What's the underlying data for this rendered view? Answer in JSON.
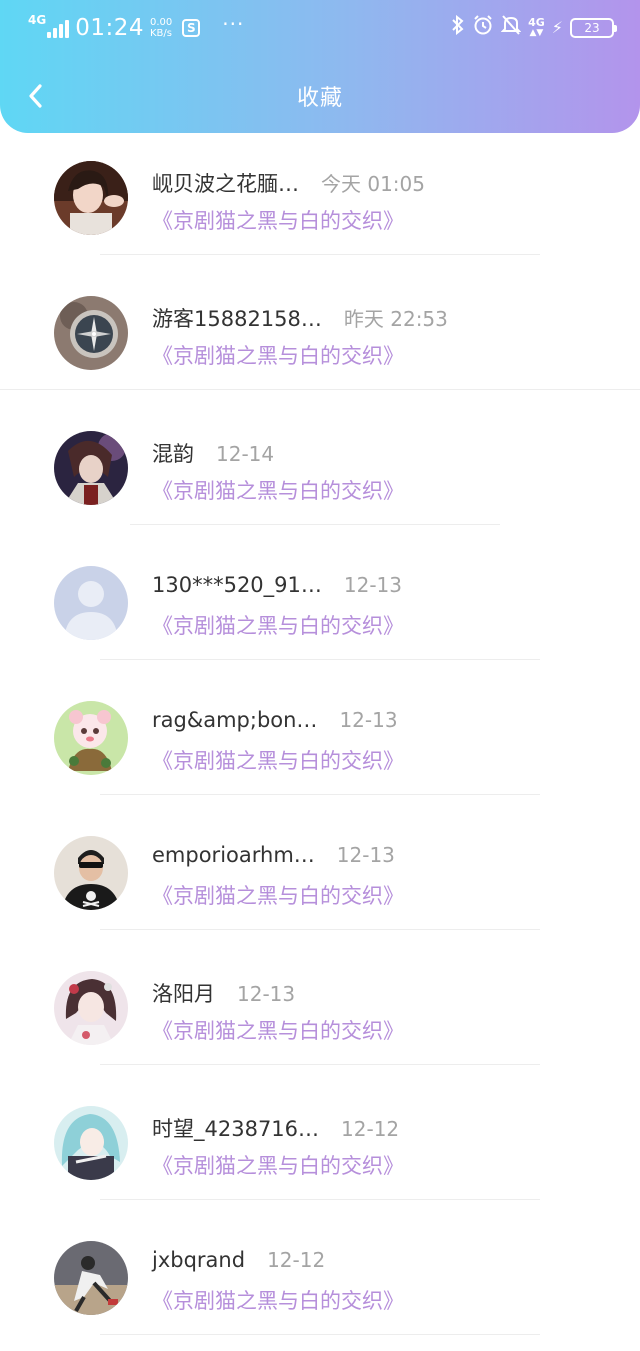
{
  "status_bar": {
    "network_left": "4G",
    "time": "01:24",
    "speed_value": "0.00",
    "speed_unit": "KB/s",
    "more": "···",
    "network_right": "4G",
    "battery": "23"
  },
  "header": {
    "title": "收藏",
    "back_icon": "chevron-left-icon"
  },
  "items": [
    {
      "name": "岘贝波之花腼…",
      "time": "今天 01:05",
      "work": "《京剧猫之黑与白的交织》"
    },
    {
      "name": "游客15882158…",
      "time": "昨天 22:53",
      "work": "《京剧猫之黑与白的交织》"
    },
    {
      "name": "混韵",
      "time": "12-14",
      "work": "《京剧猫之黑与白的交织》"
    },
    {
      "name": "130***520_91…",
      "time": "12-13",
      "work": "《京剧猫之黑与白的交织》"
    },
    {
      "name": "rag&amp;bon…",
      "time": "12-13",
      "work": "《京剧猫之黑与白的交织》"
    },
    {
      "name": "emporioarhm…",
      "time": "12-13",
      "work": "《京剧猫之黑与白的交织》"
    },
    {
      "name": "洛阳月",
      "time": "12-13",
      "work": "《京剧猫之黑与白的交织》"
    },
    {
      "name": "时望_4238716…",
      "time": "12-12",
      "work": "《京剧猫之黑与白的交织》"
    },
    {
      "name": "jxbqrand",
      "time": "12-12",
      "work": "《京剧猫之黑与白的交织》"
    }
  ],
  "colors": {
    "header_gradient": [
      "#5fd7f4",
      "#8fb8ef",
      "#b394ec"
    ],
    "work_title": "#b68fdb",
    "name": "#333333",
    "time": "#a4a4a4"
  }
}
